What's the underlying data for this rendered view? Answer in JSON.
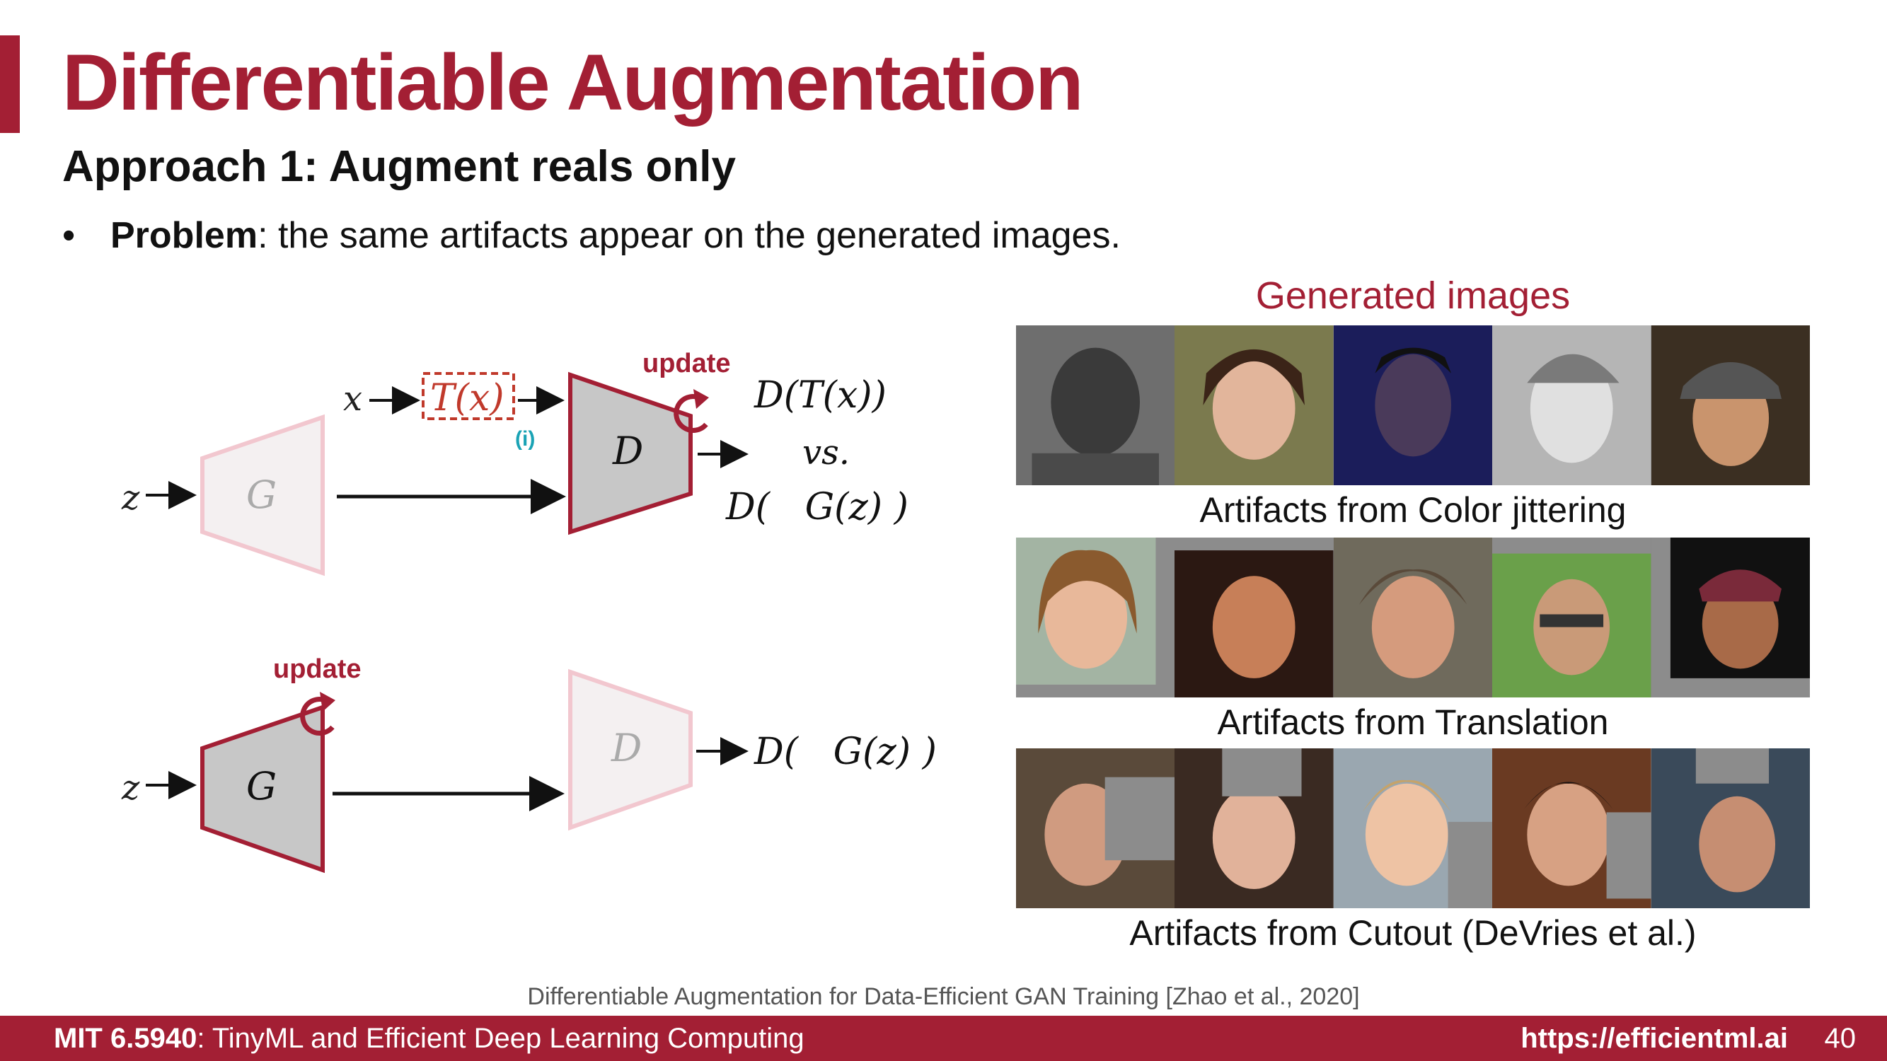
{
  "slide": {
    "title": "Differentiable Augmentation",
    "subtitle": "Approach 1: Augment reals only",
    "bullet": {
      "marker": "•",
      "bold": "Problem",
      "text": ": the same artifacts appear on the generated images."
    }
  },
  "diagram": {
    "top": {
      "z": "z",
      "G": "G",
      "x": "x",
      "T": "T(x)",
      "info_tag": "(i)",
      "D": "D",
      "update": "update",
      "out1": "D(T(x))",
      "vs": "vs.",
      "out2": "D(   G(z) )"
    },
    "bottom": {
      "z": "z",
      "G": "G",
      "D": "D",
      "update": "update",
      "out": "D(   G(z) )"
    }
  },
  "generated": {
    "heading": "Generated images",
    "rows": [
      {
        "caption": "Artifacts from Color jittering",
        "artifact": "color-jitter"
      },
      {
        "caption": "Artifacts from Translation",
        "artifact": "translation"
      },
      {
        "caption": "Artifacts from Cutout (DeVries et al.)",
        "artifact": "cutout"
      }
    ]
  },
  "citation": "Differentiable Augmentation for Data-Efficient GAN Training [Zhao et al., 2020]",
  "footer": {
    "course_code": "MIT 6.5940",
    "course_name": ": TinyML and Efficient Deep Learning Computing",
    "url": "https://efficientml.ai",
    "page": "40"
  },
  "colors": {
    "brand": "#a31f34",
    "augment_box": "#c0392b",
    "info_tag": "#1aa3b5",
    "muted_pink": "#f2c7cf"
  }
}
